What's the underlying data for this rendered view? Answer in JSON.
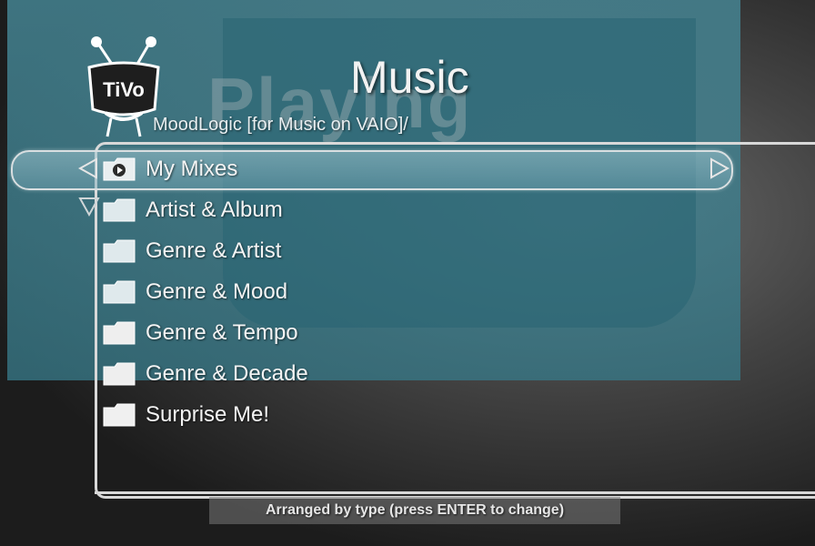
{
  "header": {
    "title": "Music",
    "watermark": "Playing",
    "breadcrumb": "MoodLogic [for Music on VAIO]/"
  },
  "logo": {
    "text": "TiVo"
  },
  "menu": {
    "items": [
      {
        "label": "My Mixes",
        "icon": "play-folder-icon",
        "selected": true
      },
      {
        "label": "Artist & Album",
        "icon": "folder-icon"
      },
      {
        "label": "Genre & Artist",
        "icon": "folder-icon"
      },
      {
        "label": "Genre & Mood",
        "icon": "folder-icon"
      },
      {
        "label": "Genre & Tempo",
        "icon": "folder-icon"
      },
      {
        "label": "Genre & Decade",
        "icon": "folder-icon"
      },
      {
        "label": "Surprise Me!",
        "icon": "folder-icon"
      }
    ]
  },
  "footer": {
    "hint": "Arranged by type (press ENTER to change)"
  },
  "colors": {
    "panel": "#468796",
    "highlight_border": "#d9dfe1",
    "text": "#f4f4f4"
  }
}
